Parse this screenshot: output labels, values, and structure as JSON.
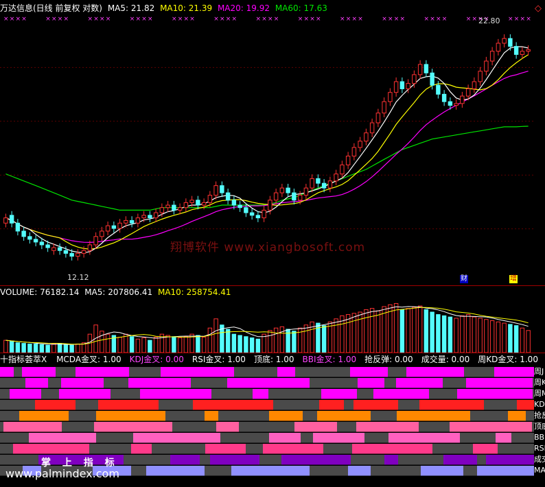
{
  "header": {
    "title": "万达信息(日线 前复权 对数)",
    "ma5": "MA5: 21.82",
    "ma10": "MA10: 21.39",
    "ma20": "MA20: 19.92",
    "ma60": "MA60: 17.63"
  },
  "price_labels": {
    "high": "22.80",
    "low": "12.12"
  },
  "markers": {
    "cai": "财",
    "zeng": "增"
  },
  "watermarks": {
    "cn": "翔博软件 www.xiangbosoft.com",
    "zhang": "掌 上 指 标",
    "url": "www.palmindex.com"
  },
  "volume_header": {
    "vol": "VOLUME: 76182.14",
    "ma5": "MA5: 207806.41",
    "ma10": "MA10: 258754.41"
  },
  "indicator_header": {
    "name": "十指标荟萃X",
    "items": [
      {
        "text": "MCDA金叉: 1.00",
        "color": "#ffffff"
      },
      {
        "text": "KDJ金叉: 0.00",
        "color": "#ff44ff"
      },
      {
        "text": "RSI金叉: 1.00",
        "color": "#ffffff"
      },
      {
        "text": "顶底: 1.00",
        "color": "#ffffff"
      },
      {
        "text": "BBI金叉: 1.00",
        "color": "#ff44ff"
      },
      {
        "text": "抢反弹: 0.00",
        "color": "#ffffff"
      },
      {
        "text": "成交量: 0.00",
        "color": "#ffffff"
      },
      {
        "text": "周KD金叉: 1.00",
        "color": "#ffffff"
      }
    ]
  },
  "row_labels": [
    "周J",
    "周K",
    "周MA",
    "KD",
    "抢反",
    "顶底",
    "BBI",
    "RSI",
    "成交",
    "MA"
  ],
  "colors": {
    "up": "#ff3232",
    "down": "#54fcfc",
    "ma5": "#ffffff",
    "ma10": "#ffff00",
    "ma20": "#ff00ff",
    "ma60": "#00e600"
  },
  "chart_data": {
    "type": "candlestick",
    "ylim": [
      11.5,
      23.5
    ],
    "close": [
      13.6,
      13.4,
      13.1,
      12.9,
      12.8,
      12.7,
      12.6,
      12.5,
      12.5,
      12.4,
      12.3,
      12.2,
      12.3,
      12.4,
      12.6,
      12.9,
      13.1,
      13.3,
      13.2,
      13.4,
      13.5,
      13.4,
      13.6,
      13.7,
      13.6,
      13.8,
      14.0,
      14.1,
      13.9,
      14.0,
      14.2,
      14.3,
      14.1,
      14.2,
      14.5,
      14.9,
      14.6,
      14.3,
      14.1,
      14.0,
      13.8,
      13.7,
      13.6,
      13.9,
      14.3,
      14.6,
      14.8,
      14.6,
      14.3,
      14.5,
      14.8,
      15.2,
      15.0,
      14.8,
      15.1,
      15.4,
      15.8,
      16.2,
      16.6,
      16.9,
      17.3,
      17.8,
      18.3,
      18.9,
      19.4,
      20.0,
      19.6,
      19.9,
      20.4,
      21.0,
      20.5,
      19.8,
      19.3,
      18.9,
      18.7,
      18.8,
      19.2,
      19.6,
      20.0,
      20.6,
      21.2,
      21.8,
      22.3,
      22.6,
      22.1,
      21.6,
      21.8,
      21.9
    ],
    "open": [
      13.4,
      13.7,
      13.4,
      13.1,
      12.9,
      12.8,
      12.7,
      12.6,
      12.4,
      12.5,
      12.4,
      12.3,
      12.2,
      12.3,
      12.4,
      12.6,
      12.9,
      13.1,
      13.3,
      13.2,
      13.4,
      13.5,
      13.4,
      13.6,
      13.7,
      13.6,
      13.8,
      14.0,
      14.1,
      13.9,
      14.0,
      14.2,
      14.3,
      14.1,
      14.2,
      14.5,
      14.9,
      14.6,
      14.3,
      14.1,
      14.0,
      13.8,
      13.7,
      13.6,
      13.9,
      14.3,
      14.6,
      14.8,
      14.6,
      14.3,
      14.5,
      14.8,
      15.2,
      15.0,
      14.8,
      15.1,
      15.4,
      15.8,
      16.2,
      16.6,
      16.9,
      17.3,
      17.8,
      18.3,
      18.9,
      19.4,
      20.0,
      19.6,
      19.9,
      20.4,
      21.0,
      20.5,
      19.8,
      19.3,
      18.9,
      18.7,
      18.8,
      19.2,
      19.6,
      20.0,
      20.6,
      21.2,
      21.8,
      22.3,
      22.6,
      22.1,
      21.6,
      21.8
    ],
    "ma60": [
      15.4,
      15.3,
      15.2,
      15.1,
      15.0,
      14.9,
      14.8,
      14.7,
      14.6,
      14.5,
      14.4,
      14.3,
      14.25,
      14.2,
      14.15,
      14.1,
      14.05,
      14.0,
      13.95,
      13.9,
      13.9,
      13.9,
      13.9,
      13.9,
      13.9,
      13.95,
      14.0,
      14.0,
      14.0,
      14.0,
      14.0,
      14.0,
      14.0,
      14.0,
      14.0,
      14.05,
      14.1,
      14.1,
      14.1,
      14.1,
      14.1,
      14.1,
      14.1,
      14.1,
      14.15,
      14.2,
      14.3,
      14.35,
      14.4,
      14.5,
      14.6,
      14.7,
      14.8,
      14.9,
      15.0,
      15.1,
      15.2,
      15.3,
      15.4,
      15.5,
      15.6,
      15.75,
      15.9,
      16.05,
      16.2,
      16.35,
      16.5,
      16.6,
      16.7,
      16.8,
      16.9,
      17.0,
      17.05,
      17.1,
      17.15,
      17.2,
      17.25,
      17.3,
      17.35,
      17.4,
      17.45,
      17.5,
      17.55,
      17.6,
      17.6,
      17.6,
      17.62,
      17.63
    ],
    "volume": [
      20,
      18,
      16,
      15,
      14,
      14,
      13,
      12,
      14,
      15,
      13,
      12,
      14,
      16,
      30,
      45,
      35,
      30,
      28,
      25,
      30,
      26,
      22,
      24,
      20,
      25,
      30,
      28,
      26,
      24,
      26,
      30,
      28,
      25,
      40,
      55,
      45,
      38,
      30,
      28,
      26,
      24,
      22,
      30,
      36,
      40,
      42,
      38,
      35,
      40,
      45,
      50,
      48,
      44,
      50,
      55,
      60,
      62,
      64,
      66,
      70,
      72,
      68,
      75,
      78,
      80,
      70,
      72,
      74,
      76,
      70,
      66,
      62,
      60,
      58,
      56,
      60,
      62,
      58,
      56,
      54,
      52,
      50,
      48,
      46,
      44,
      40,
      36
    ],
    "volume_ylim": [
      0,
      85
    ]
  }
}
